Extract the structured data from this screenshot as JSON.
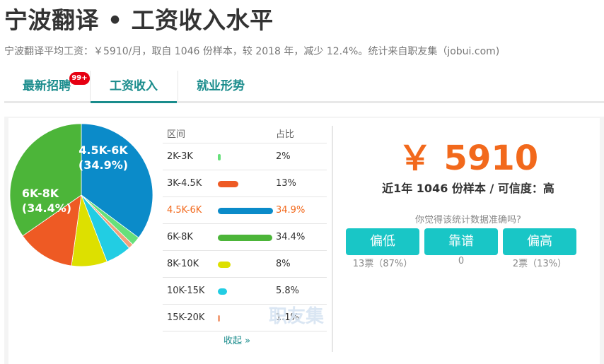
{
  "header": {
    "title": "宁波翻译 • 工资收入水平",
    "subtitle": "宁波翻译平均工资：￥5910/月，取自 1046 份样本，较 2018 年，减少 12.4%。统计来自职友集（jobui.com)"
  },
  "tabs": [
    {
      "label": "最新招聘",
      "badge": "99+",
      "active": false
    },
    {
      "label": "工资收入",
      "active": true
    },
    {
      "label": "就业形势",
      "active": false
    }
  ],
  "table": {
    "head_range": "区间",
    "head_ratio": "占比",
    "rows": [
      {
        "range": "2K-3K",
        "pct": "2%"
      },
      {
        "range": "3K-4.5K",
        "pct": "13%"
      },
      {
        "range": "4.5K-6K",
        "pct": "34.9%"
      },
      {
        "range": "6K-8K",
        "pct": "34.4%"
      },
      {
        "range": "8K-10K",
        "pct": "8%"
      },
      {
        "range": "10K-15K",
        "pct": "5.8%"
      },
      {
        "range": "15K-20K",
        "pct": "1.1%"
      }
    ],
    "collapse_label": "收起 »",
    "watermark": "职友集"
  },
  "pie_labels": {
    "a_range": "4.5K-6K",
    "a_pct": "(34.9%)",
    "b_range": "6K-8K",
    "b_pct": "(34.4%)"
  },
  "chart_data": {
    "type": "pie",
    "categories": [
      "2K-3K",
      "3K-4.5K",
      "4.5K-6K",
      "6K-8K",
      "8K-10K",
      "10K-15K",
      "15K-20K"
    ],
    "values": [
      2,
      13,
      34.9,
      34.4,
      8,
      5.8,
      1.1
    ],
    "colors": [
      "#66e07a",
      "#ee5a24",
      "#0b8bc9",
      "#4cb539",
      "#dde000",
      "#22cde3",
      "#f2a07b"
    ]
  },
  "summary": {
    "salary": "￥ 5910",
    "sample_text": "近1年 1046 份样本 / 可信度：高",
    "question": "你觉得该统计数据准确吗?"
  },
  "votes": [
    {
      "label": "偏低",
      "count": "13票（87%）"
    },
    {
      "label": "靠谱",
      "count": "0"
    },
    {
      "label": "偏高",
      "count": "2票（13%）"
    }
  ],
  "colors": {
    "accent": "#1a8c8c",
    "orange": "#f2691c",
    "button": "#19c6c6"
  }
}
